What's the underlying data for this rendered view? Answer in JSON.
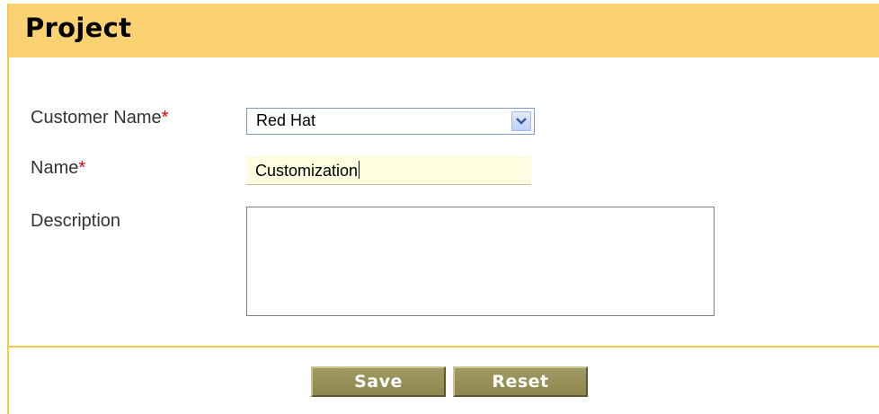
{
  "header": {
    "title": "Project"
  },
  "form": {
    "customer_name": {
      "label": "Customer Name",
      "required_mark": "*",
      "selected_value": "Red Hat"
    },
    "name": {
      "label": "Name",
      "required_mark": "*",
      "value": "Customization"
    },
    "description": {
      "label": "Description",
      "value": ""
    }
  },
  "actions": {
    "save_label": "Save",
    "reset_label": "Reset"
  },
  "colors": {
    "header_bg": "#fad271",
    "accent_border": "#f5c84b",
    "button_bg": "#9a945c",
    "required": "#e00000",
    "input_highlight": "#fdfde0"
  },
  "icons": {
    "dropdown": "chevron-down-icon"
  }
}
